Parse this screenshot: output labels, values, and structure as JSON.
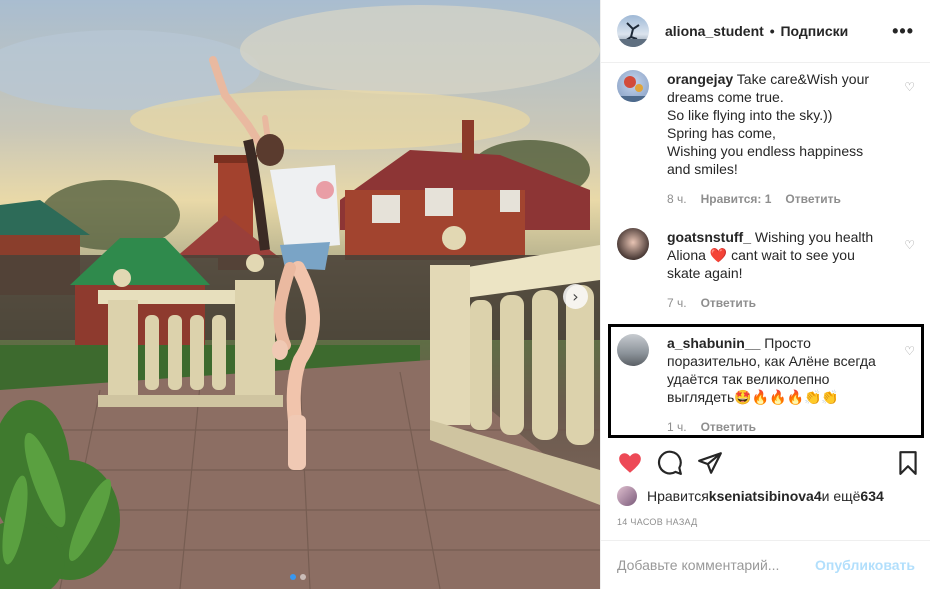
{
  "colors": {
    "accent": "#3897f0",
    "like_red": "#ed4956",
    "meta_gray": "#8e8e8e",
    "publish_disabled": "#b2dffc"
  },
  "photo": {
    "carousel_pages": 2,
    "current_page": 1,
    "next_icon": "chevron-right-icon"
  },
  "header": {
    "username": "aliona_student",
    "separator": "•",
    "follow_label": "Подписки",
    "more_icon": "ellipsis-icon",
    "more_label": "•••"
  },
  "comments": [
    {
      "username": "orangejay",
      "text": " Take care&Wish your dreams come true.\nSo like flying into the sky.))\nSpring has come,\nWishing you endless happiness\nand smiles!",
      "time": "8 ч.",
      "likes": "Нравится: 1",
      "reply": "Ответить",
      "heart_icon": "♡"
    },
    {
      "username": "goatsnstuff_",
      "text": " Wishing you health Aliona ❤️ cant wait to see you skate again!",
      "time": "7 ч.",
      "reply": "Ответить",
      "heart_icon": "♡"
    },
    {
      "username": "a_shabunin__",
      "text": " Просто поразительно, как Алёне всегда удаётся так великолепно выглядеть🤩🔥🔥🔥👏👏",
      "time": "1 ч.",
      "reply": "Ответить",
      "heart_icon": "♡"
    }
  ],
  "actions": {
    "like_icon": "heart-filled-icon",
    "comment_icon": "comment-icon",
    "share_icon": "paper-plane-icon",
    "save_icon": "bookmark-icon"
  },
  "likes": {
    "prefix": "Нравится ",
    "user": "kseniatsibinova4",
    "middle": " и ещё ",
    "count": "634"
  },
  "timestamp": "14 часов назад",
  "add_comment": {
    "placeholder": "Добавьте комментарий...",
    "publish_label": "Опубликовать"
  }
}
